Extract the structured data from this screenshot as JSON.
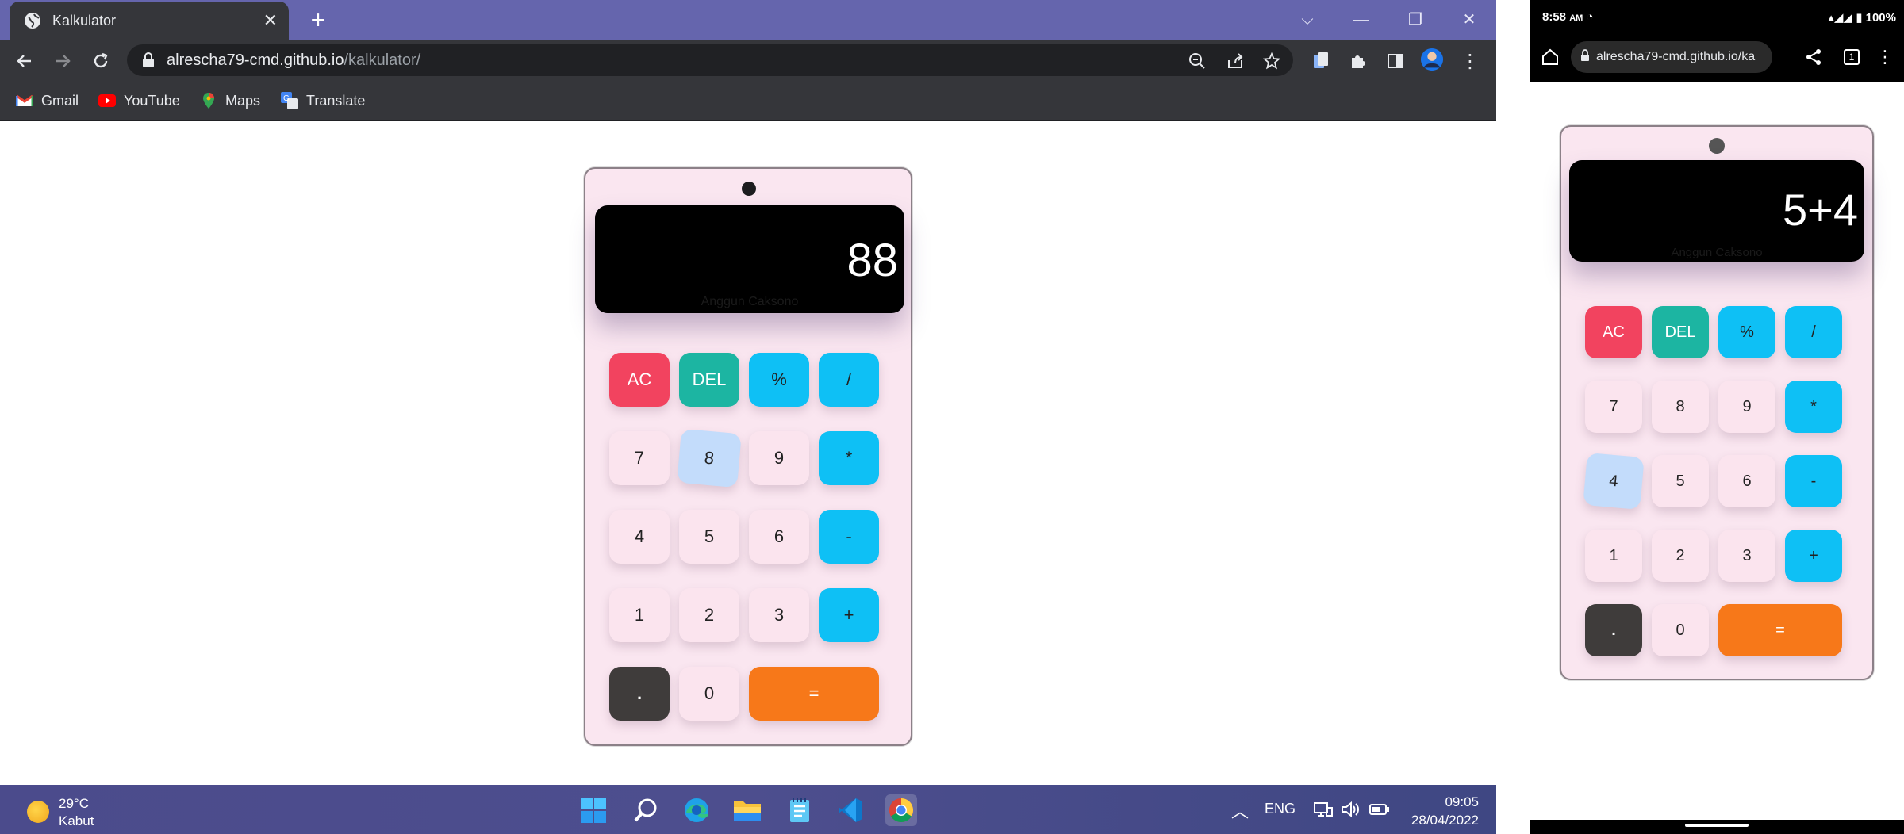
{
  "browser": {
    "tab_title": "Kalkulator",
    "url_host": "alrescha79-cmd.github.io",
    "url_path": "/kalkulator/",
    "bookmarks": [
      {
        "label": "Gmail"
      },
      {
        "label": "YouTube"
      },
      {
        "label": "Maps"
      },
      {
        "label": "Translate"
      }
    ]
  },
  "desktop_calc": {
    "display": "88",
    "credit": "Anggun Caksono",
    "keys": [
      {
        "label": "AC",
        "kind": "ac"
      },
      {
        "label": "DEL",
        "kind": "del"
      },
      {
        "label": "%",
        "kind": "op"
      },
      {
        "label": "/",
        "kind": "op"
      },
      {
        "label": "7",
        "kind": "num"
      },
      {
        "label": "8",
        "kind": "num",
        "pressed": true
      },
      {
        "label": "9",
        "kind": "num"
      },
      {
        "label": "*",
        "kind": "op"
      },
      {
        "label": "4",
        "kind": "num"
      },
      {
        "label": "5",
        "kind": "num"
      },
      {
        "label": "6",
        "kind": "num"
      },
      {
        "label": "-",
        "kind": "op"
      },
      {
        "label": "1",
        "kind": "num"
      },
      {
        "label": "2",
        "kind": "num"
      },
      {
        "label": "3",
        "kind": "num"
      },
      {
        "label": "+",
        "kind": "op"
      },
      {
        "label": ".",
        "kind": "dot"
      },
      {
        "label": "0",
        "kind": "num"
      },
      {
        "label": "=",
        "kind": "eq"
      }
    ]
  },
  "mobile_calc": {
    "display": "5+4",
    "credit": "Anggun Caksono",
    "keys": [
      {
        "label": "AC",
        "kind": "ac"
      },
      {
        "label": "DEL",
        "kind": "del"
      },
      {
        "label": "%",
        "kind": "op"
      },
      {
        "label": "/",
        "kind": "op"
      },
      {
        "label": "7",
        "kind": "num"
      },
      {
        "label": "8",
        "kind": "num"
      },
      {
        "label": "9",
        "kind": "num"
      },
      {
        "label": "*",
        "kind": "op"
      },
      {
        "label": "4",
        "kind": "num",
        "pressed": true
      },
      {
        "label": "5",
        "kind": "num"
      },
      {
        "label": "6",
        "kind": "num"
      },
      {
        "label": "-",
        "kind": "op"
      },
      {
        "label": "1",
        "kind": "num"
      },
      {
        "label": "2",
        "kind": "num"
      },
      {
        "label": "3",
        "kind": "num"
      },
      {
        "label": "+",
        "kind": "op"
      },
      {
        "label": ".",
        "kind": "dot"
      },
      {
        "label": "0",
        "kind": "num"
      },
      {
        "label": "=",
        "kind": "eq"
      }
    ]
  },
  "taskbar": {
    "weather_temp": "29°C",
    "weather_desc": "Kabut",
    "language": "ENG",
    "time": "09:05",
    "date": "28/04/2022"
  },
  "mobile": {
    "status_time": "8:58",
    "status_ampm": "AM",
    "battery": "100%",
    "url": "alrescha79-cmd.github.io/ka",
    "tab_count": "1"
  },
  "colors": {
    "ac": "#f2435f",
    "del": "#1cb5a2",
    "op": "#0ec0f5",
    "dot": "#3f3c3b",
    "eq": "#f77819",
    "num": "#fbe4ee",
    "calc_body": "#fae6f0"
  }
}
